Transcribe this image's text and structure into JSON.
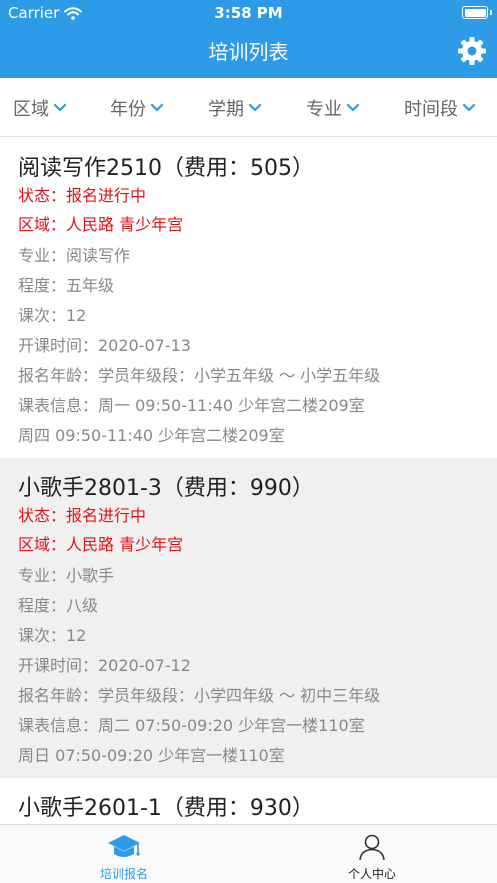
{
  "status_bar": {
    "carrier": "Carrier",
    "time": "3:58 PM"
  },
  "nav": {
    "title": "培训列表"
  },
  "filters": [
    "区域",
    "年份",
    "学期",
    "专业",
    "时间段"
  ],
  "courses": [
    {
      "title": "阅读写作2510（费用：505）",
      "status": "状态：报名进行中",
      "region": "区域：人民路 青少年宫",
      "major": "专业：阅读写作",
      "level": "程度：五年级",
      "sessions": "课次：12",
      "start": "开课时间：2020-07-13",
      "age": "报名年龄：学员年级段：小学五年级 ～ 小学五年级",
      "schedule1": "课表信息：周一 09:50-11:40 少年宫二楼209室",
      "schedule2": "周四 09:50-11:40 少年宫二楼209室"
    },
    {
      "title": "小歌手2801-3（费用：990）",
      "status": "状态：报名进行中",
      "region": "区域：人民路 青少年宫",
      "major": "专业：小歌手",
      "level": "程度：八级",
      "sessions": "课次：12",
      "start": "开课时间：2020-07-12",
      "age": "报名年龄：学员年级段：小学四年级 ～ 初中三年级",
      "schedule1": "课表信息：周二 07:50-09:20 少年宫一楼110室",
      "schedule2": "周日 07:50-09:20 少年宫一楼110室"
    },
    {
      "title": "小歌手2601-1（费用：930）"
    }
  ],
  "tabs": [
    "培训报名",
    "个人中心"
  ],
  "colors": {
    "primary": "#2d9be8",
    "status_red": "#e0121b",
    "selected_row": "#f0f0f0"
  }
}
